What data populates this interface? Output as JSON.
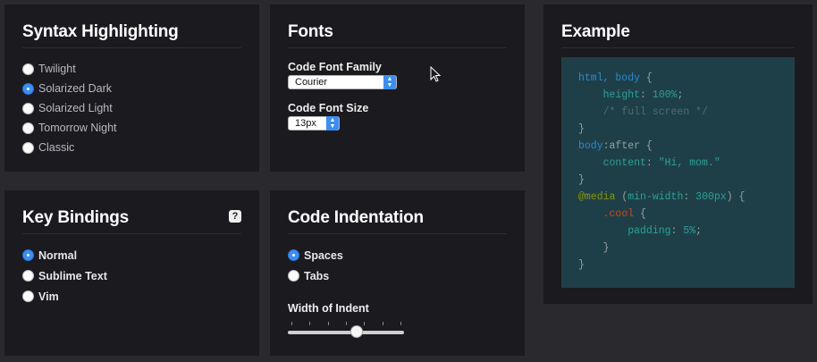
{
  "syntax": {
    "title": "Syntax Highlighting",
    "options": [
      {
        "label": "Twilight",
        "checked": false
      },
      {
        "label": "Solarized Dark",
        "checked": true
      },
      {
        "label": "Solarized Light",
        "checked": false
      },
      {
        "label": "Tomorrow Night",
        "checked": false
      },
      {
        "label": "Classic",
        "checked": false
      }
    ]
  },
  "fonts": {
    "title": "Fonts",
    "family_label": "Code Font Family",
    "family_value": "Courier",
    "size_label": "Code Font Size",
    "size_value": "13px"
  },
  "keys": {
    "title": "Key Bindings",
    "help_icon": "?",
    "options": [
      {
        "label": "Normal",
        "checked": true
      },
      {
        "label": "Sublime Text",
        "checked": false
      },
      {
        "label": "Vim",
        "checked": false
      }
    ]
  },
  "indent": {
    "title": "Code Indentation",
    "options": [
      {
        "label": "Spaces",
        "checked": true
      },
      {
        "label": "Tabs",
        "checked": false
      }
    ],
    "width_label": "Width of Indent",
    "slider_fraction": 0.6
  },
  "example": {
    "title": "Example",
    "code_lines": [
      [
        [
          "html, body",
          "sel"
        ],
        [
          " {",
          "pun"
        ]
      ],
      [
        [
          "    ",
          "pun"
        ],
        [
          "height",
          "prop"
        ],
        [
          ": ",
          "pun"
        ],
        [
          "100%",
          "val"
        ],
        [
          ";",
          "pun"
        ]
      ],
      [
        [
          "    ",
          "pun"
        ],
        [
          "/* full screen */",
          "com"
        ]
      ],
      [
        [
          "}",
          "pun"
        ]
      ],
      [
        [
          "body",
          "sel"
        ],
        [
          ":after {",
          "pun"
        ]
      ],
      [
        [
          "    ",
          "pun"
        ],
        [
          "content",
          "prop"
        ],
        [
          ": ",
          "pun"
        ],
        [
          "\"Hi, mom.\"",
          "str"
        ]
      ],
      [
        [
          "}",
          "pun"
        ]
      ],
      [
        [
          "@media",
          "at"
        ],
        [
          " (",
          "pun"
        ],
        [
          "min-width",
          "prop"
        ],
        [
          ": ",
          "pun"
        ],
        [
          "300px",
          "val"
        ],
        [
          ") {",
          "pun"
        ]
      ],
      [
        [
          "    ",
          "pun"
        ],
        [
          ".cool",
          "cls"
        ],
        [
          " {",
          "pun"
        ]
      ],
      [
        [
          "        ",
          "pun"
        ],
        [
          "padding",
          "prop"
        ],
        [
          ": ",
          "pun"
        ],
        [
          "5%",
          "val"
        ],
        [
          ";",
          "pun"
        ]
      ],
      [
        [
          "    ",
          "pun"
        ],
        [
          "}",
          "pun"
        ]
      ],
      [
        [
          "}",
          "pun"
        ]
      ]
    ]
  }
}
